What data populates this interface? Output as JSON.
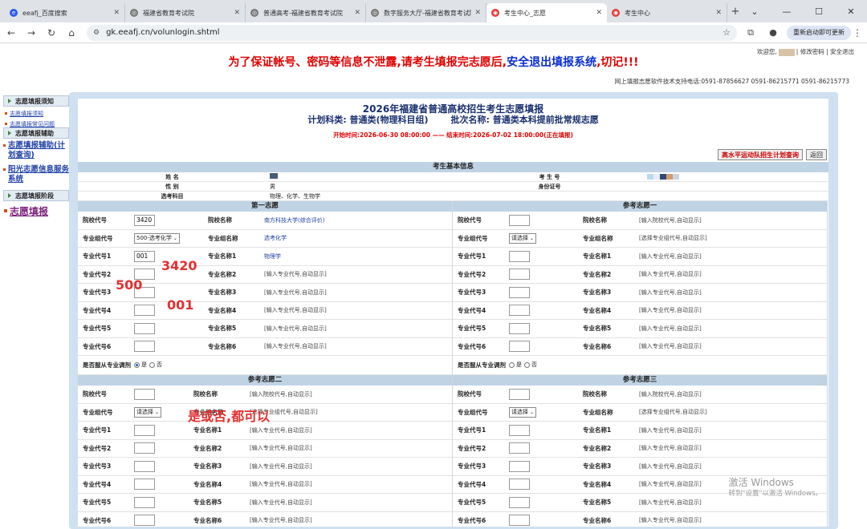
{
  "browser": {
    "tabs": [
      {
        "label": "eeafj_百度搜索",
        "color": "#2f5bea",
        "glyph": "e",
        "active": false
      },
      {
        "label": "福建省教育考试院",
        "color": "#777777",
        "glyph": "◎",
        "active": false
      },
      {
        "label": "普通高考-福建省教育考试院",
        "color": "#777777",
        "glyph": "◎",
        "active": false
      },
      {
        "label": "数字服务大厅-福建省教育考试院",
        "color": "#777777",
        "glyph": "◎",
        "active": false
      },
      {
        "label": "考生中心_志愿",
        "color": "#e53935",
        "glyph": "◉",
        "active": true
      },
      {
        "label": "考生中心",
        "color": "#e53935",
        "glyph": "◉",
        "active": false
      }
    ],
    "url": "gk.eeafj.cn/volunlogin.shtml",
    "relaunch": "重新启动即可更新"
  },
  "top": {
    "user_prefix": "欢迎您,",
    "user_links": "| 修改密码 | 安全退出",
    "warn_red": "为了保证帐号、密码等信息不泄露,请考生填报完志愿后,",
    "warn_blue": "安全退出填报系统",
    "warn_red2": ",切记!!!",
    "tel": "网上填报志愿软件技术支持电话:0591-87856627 0591-86215771 0591-86215773"
  },
  "sidebar": {
    "h1": "志愿填报须知",
    "l1": "志愿填报须知",
    "l2": "志愿填报常见问题",
    "h2": "志愿填报辅助",
    "l3": "志愿填报辅助(计划查询)",
    "l4": "阳光志愿信息服务系统",
    "h3": "志愿填报阶段",
    "l5": "志愿填报"
  },
  "header": {
    "title": "2026年福建省普通高校招生考生志愿填报",
    "subject": "计划科类: 普通类(物理科目组)",
    "batch": "批次名称: 普通类本科提前批常规志愿",
    "time": "开始时间:2026-06-30 08:00:00 —— 结束时间:2026-07-02 18:00:00(正在填报)",
    "btn_query": "高水平运动队招生计划查询",
    "btn_back": "返回"
  },
  "info": {
    "section": "考生基本信息",
    "name_k": "姓 名",
    "gender_k": "性 别",
    "gender_v": "男",
    "subjects_k": "选考科目",
    "subjects_v": "物理、化学、生物学",
    "id_k": "考 生 号",
    "card_k": "身份证号"
  },
  "labels": {
    "school_code": "院校代号",
    "school_name": "院校名称",
    "group_code": "专业组代号",
    "group_name": "专业组名称",
    "m1c": "专业代号1",
    "m1n": "专业名称1",
    "m2c": "专业代号2",
    "m2n": "专业名称2",
    "m3c": "专业代号3",
    "m3n": "专业名称3",
    "m4c": "专业代号4",
    "m4n": "专业名称4",
    "m5c": "专业代号5",
    "m5n": "专业名称5",
    "m6c": "专业代号6",
    "m6n": "专业名称6",
    "adjust": "是否服从专业调剂",
    "yes": "是",
    "no": "否",
    "ph_school": "[输入院校代号,自动显示]",
    "ph_group": "[选择专业组代号,自动显示]",
    "ph_major": "[输入专业代号,自动显示]",
    "select_ph": "请选择"
  },
  "vol1": {
    "title": "第一志愿",
    "school_code": "3420",
    "school_name": "南方科技大学(综合评价)",
    "group_code": "500-选考化学",
    "group_name": "选考化学",
    "m1_code": "001",
    "m1_name": "物理学"
  },
  "vol_ref1": {
    "title": "参考志愿一"
  },
  "vol_ref2": {
    "title": "参考志愿二"
  },
  "vol_ref3": {
    "title": "参考志愿三"
  },
  "annotations": {
    "a1": "3420",
    "a2": "500",
    "a3": "001",
    "a4": "是或否,都可以"
  },
  "watermark": {
    "l1": "激活 Windows",
    "l2": "转到\"设置\"以激活 Windows。"
  }
}
